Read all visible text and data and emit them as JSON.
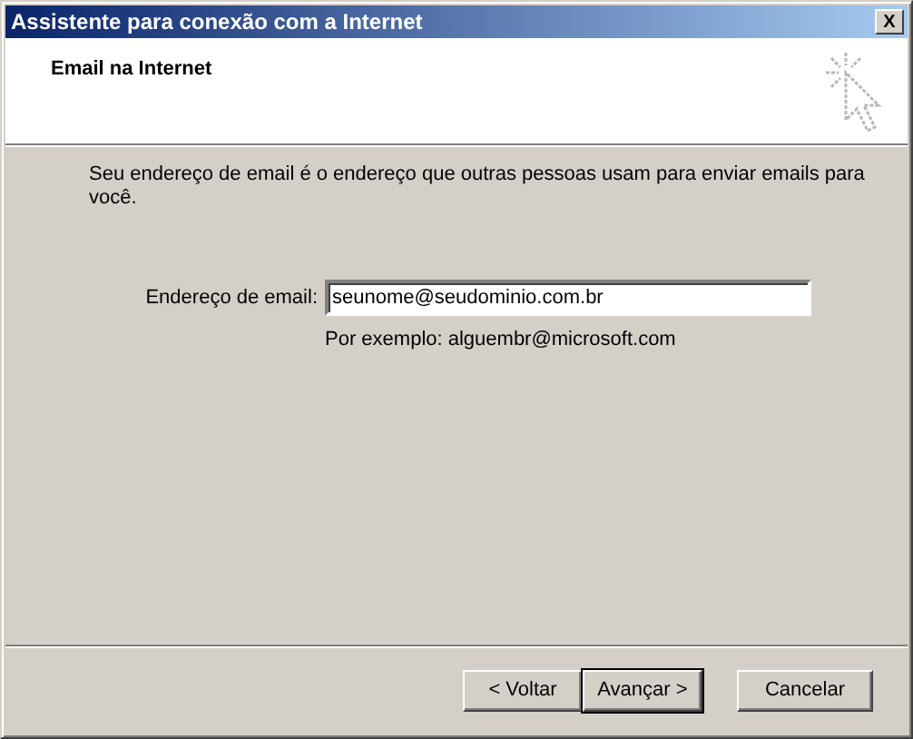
{
  "window": {
    "title": "Assistente para conexão com a Internet",
    "close_button": "X"
  },
  "header": {
    "title": "Email na Internet"
  },
  "description": "Seu endereço de email é o endereço que outras pessoas usam para enviar emails para você.",
  "email_field": {
    "label": "Endereço de email:",
    "value": "seunome@seudominio.com.br",
    "example": "Por exemplo: alguembr@microsoft.com"
  },
  "buttons": [
    {
      "label": "< Voltar",
      "default": false
    },
    {
      "label": "Avançar >",
      "default": true
    },
    {
      "label": "Cancelar",
      "default": false
    }
  ]
}
